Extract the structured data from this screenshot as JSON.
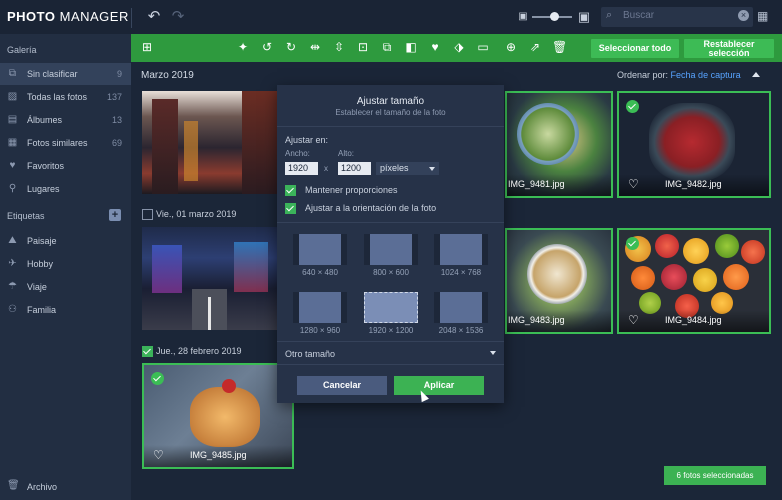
{
  "app": {
    "logo_bold": "PHOTO",
    "logo_rest": "MANAGER"
  },
  "topbar": {
    "undo_icon": "undo-icon",
    "redo_icon": "redo-icon",
    "search_placeholder": "Buscar",
    "zoom_level_fraction": 0.55
  },
  "sidebar": {
    "gallery_header": "Galería",
    "items": [
      {
        "label": "Sin clasificar",
        "count": "9",
        "icon": "unsorted-icon",
        "active": true
      },
      {
        "label": "Todas las fotos",
        "count": "137",
        "icon": "photos-icon"
      },
      {
        "label": "Álbumes",
        "count": "13",
        "icon": "albums-icon"
      },
      {
        "label": "Fotos similares",
        "count": "69",
        "icon": "similar-icon"
      },
      {
        "label": "Favoritos",
        "count": "",
        "icon": "heart-icon"
      },
      {
        "label": "Lugares",
        "count": "",
        "icon": "pin-icon"
      }
    ],
    "tags_header": "Etiquetas",
    "tags": [
      {
        "label": "Paisaje",
        "icon": "landscape-icon"
      },
      {
        "label": "Hobby",
        "icon": "hobby-icon"
      },
      {
        "label": "Viaje",
        "icon": "travel-icon"
      },
      {
        "label": "Familia",
        "icon": "family-icon"
      }
    ],
    "archive": "Archivo"
  },
  "toolbar": {
    "select_all": "Seleccionar todo",
    "reset_line1": "Restablecer",
    "reset_line2": "selección"
  },
  "content": {
    "month": "Marzo 2019",
    "sort_label": "Ordenar por:",
    "sort_value": "Fecha de captura",
    "date1": "Vie., 01 marzo 2019",
    "date2": "Jue., 28 febrero 2019",
    "photos": {
      "p9481": "IMG_9481.jpg",
      "p9482": "IMG_9482.jpg",
      "p9483": "IMG_9483.jpg",
      "p9484": "IMG_9484.jpg",
      "p9485": "IMG_9485.jpg"
    },
    "selected_count": "6 fotos seleccionadas"
  },
  "dialog": {
    "title": "Ajustar tamaño",
    "subtitle": "Establecer el tamaño de la foto",
    "fit_label": "Ajustar en:",
    "width_label": "Ancho:",
    "height_label": "Alto:",
    "width_value": "1920",
    "height_value": "1200",
    "times": "x",
    "unit": "píxeles",
    "keep_ratio": "Mantener proporciones",
    "orient": "Ajustar a la orientación de la foto",
    "presets": [
      "640 × 480",
      "800 × 600",
      "1024 × 768",
      "1280 × 960",
      "1920 × 1200",
      "2048 × 1536"
    ],
    "active_preset_index": 4,
    "other_size": "Otro tamaño",
    "cancel": "Cancelar",
    "apply": "Aplicar"
  },
  "colors": {
    "accent_green": "#3cb253",
    "toolbar_green": "#2e9a3e",
    "link_blue": "#57a3ff"
  }
}
